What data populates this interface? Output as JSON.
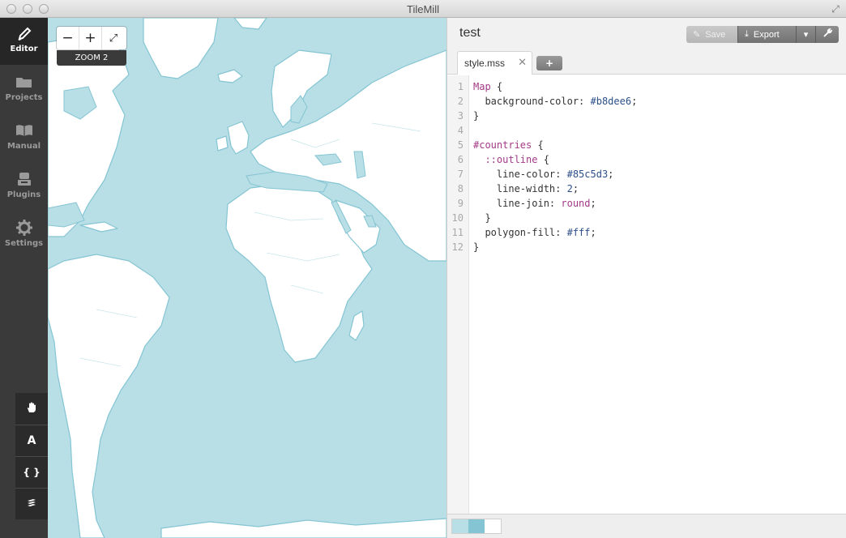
{
  "window": {
    "title": "TileMill"
  },
  "sidebar": {
    "items": [
      {
        "label": "Editor",
        "icon": "pencil-icon",
        "active": true
      },
      {
        "label": "Projects",
        "icon": "folder-icon",
        "active": false
      },
      {
        "label": "Manual",
        "icon": "book-icon",
        "active": false
      },
      {
        "label": "Plugins",
        "icon": "plugin-icon",
        "active": false
      },
      {
        "label": "Settings",
        "icon": "gear-icon",
        "active": false
      }
    ],
    "tools": [
      {
        "name": "pan-tool",
        "icon": "hand-icon",
        "glyph": ""
      },
      {
        "name": "font-tool",
        "icon": "font-icon",
        "glyph": "A"
      },
      {
        "name": "carto-tool",
        "icon": "braces-icon",
        "glyph": "{ }"
      },
      {
        "name": "layers-tool",
        "icon": "layers-icon",
        "glyph": ""
      }
    ]
  },
  "map": {
    "zoom_out": "−",
    "zoom_in": "+",
    "fullscreen": "⤢",
    "zoom_label": "ZOOM 2",
    "water_color": "#b8dee6",
    "land_color": "#ffffff",
    "outline_color": "#85c5d3"
  },
  "editor": {
    "project_title": "test",
    "buttons": {
      "save": "Save",
      "export": "Export"
    },
    "tab": {
      "label": "style.mss",
      "close": "✕"
    },
    "add_tab": "+",
    "code": [
      {
        "n": "1",
        "parts": [
          [
            "sel",
            "Map"
          ],
          [
            "plain",
            " {"
          ]
        ]
      },
      {
        "n": "2",
        "parts": [
          [
            "plain",
            "  background-color: "
          ],
          [
            "val",
            "#b8dee6"
          ],
          [
            "plain",
            ";"
          ]
        ]
      },
      {
        "n": "3",
        "parts": [
          [
            "plain",
            "}"
          ]
        ]
      },
      {
        "n": "4",
        "parts": []
      },
      {
        "n": "5",
        "parts": [
          [
            "sel",
            "#countries"
          ],
          [
            "plain",
            " {"
          ]
        ]
      },
      {
        "n": "6",
        "parts": [
          [
            "plain",
            "  "
          ],
          [
            "sel",
            "::outline"
          ],
          [
            "plain",
            " {"
          ]
        ]
      },
      {
        "n": "7",
        "parts": [
          [
            "plain",
            "    line-color: "
          ],
          [
            "val",
            "#85c5d3"
          ],
          [
            "plain",
            ";"
          ]
        ]
      },
      {
        "n": "8",
        "parts": [
          [
            "plain",
            "    line-width: "
          ],
          [
            "val",
            "2"
          ],
          [
            "plain",
            ";"
          ]
        ]
      },
      {
        "n": "9",
        "parts": [
          [
            "plain",
            "    line-join: "
          ],
          [
            "kw",
            "round"
          ],
          [
            "plain",
            ";"
          ]
        ]
      },
      {
        "n": "10",
        "parts": [
          [
            "plain",
            "  }"
          ]
        ]
      },
      {
        "n": "11",
        "parts": [
          [
            "plain",
            "  polygon-fill: "
          ],
          [
            "val",
            "#fff"
          ],
          [
            "plain",
            ";"
          ]
        ]
      },
      {
        "n": "12",
        "parts": [
          [
            "plain",
            "}"
          ]
        ]
      }
    ],
    "palette": [
      "#b8dee6",
      "#85c5d3",
      "#ffffff"
    ]
  }
}
